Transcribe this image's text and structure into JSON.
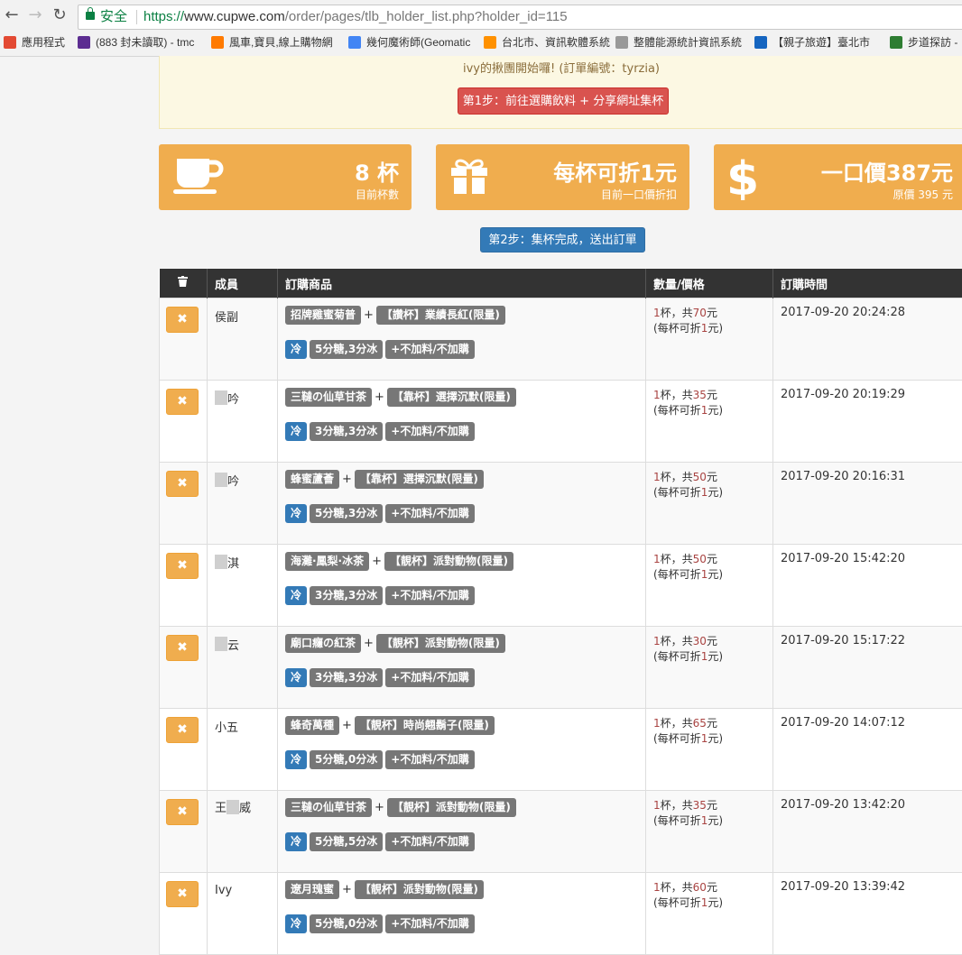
{
  "browser": {
    "secure_label": "安全",
    "url_scheme": "https://",
    "url_host": "www.cupwe.com",
    "url_path": "/order/pages/tlb_holder_list.php?holder_id=115",
    "bookmarks": [
      {
        "label": "應用程式",
        "color": "#e34a33"
      },
      {
        "label": "(883 封未讀取) - tmc",
        "color": "#5c2d91"
      },
      {
        "label": "風車,寶貝,線上購物網",
        "color": "#ff7a00"
      },
      {
        "label": "幾何魔術師(Geomatic",
        "color": "#4285f4"
      },
      {
        "label": "台北市、資訊軟體系統",
        "color": "#ff9100"
      },
      {
        "label": "整體能源統計資訊系統",
        "color": "#999999"
      },
      {
        "label": "【親子旅遊】臺北市",
        "color": "#1565c0"
      },
      {
        "label": "步道探訪 -",
        "color": "#2e7d32"
      }
    ]
  },
  "notice": {
    "text": "ivy的揪團開始囉! (訂單編號：tyrzia)",
    "step1_label": "第1步：前往選購飲料 + 分享網址集杯"
  },
  "stats": {
    "cups": {
      "big": "8 杯",
      "small": "目前杯數"
    },
    "discount": {
      "big": "每杯可折1元",
      "small": "目前一口價折扣"
    },
    "price": {
      "big": "一口價387元",
      "small": "原價 395 元"
    }
  },
  "step2_label": "第2步：集杯完成，送出訂單",
  "table": {
    "headers": {
      "member": "成員",
      "item": "訂購商品",
      "qty": "數量/價格",
      "time": "訂購時間"
    },
    "delete_glyph": "✖",
    "cold_label": "冷",
    "rows": [
      {
        "member_prefix": "",
        "member": "侯副",
        "drink": "招牌雞蜜菊普",
        "cup": "【讚杯】業績長紅(限量)",
        "sugar": "5分糖,3分冰",
        "topping": "+不加料/不加購",
        "cups": "1",
        "qty_mid": "杯，共",
        "total": "70",
        "qty_end": "元",
        "discount_pre": "(每杯可折",
        "discount": "1",
        "discount_post": "元)",
        "time": "2017-09-20 20:24:28",
        "blur": false
      },
      {
        "member_prefix": "",
        "member": "吟",
        "drink": "三韃の仙草甘茶",
        "cup": "【靠杯】選擇沉默(限量)",
        "sugar": "3分糖,3分冰",
        "topping": "+不加料/不加購",
        "cups": "1",
        "qty_mid": "杯，共",
        "total": "35",
        "qty_end": "元",
        "discount_pre": "(每杯可折",
        "discount": "1",
        "discount_post": "元)",
        "time": "2017-09-20 20:19:29",
        "blur": true
      },
      {
        "member_prefix": "",
        "member": "吟",
        "drink": "蜂蜜蘆薈",
        "cup": "【靠杯】選擇沉默(限量)",
        "sugar": "5分糖,3分冰",
        "topping": "+不加料/不加購",
        "cups": "1",
        "qty_mid": "杯，共",
        "total": "50",
        "qty_end": "元",
        "discount_pre": "(每杯可折",
        "discount": "1",
        "discount_post": "元)",
        "time": "2017-09-20 20:16:31",
        "blur": true
      },
      {
        "member_prefix": "",
        "member": "淇",
        "drink": "海灘·鳳梨·冰茶",
        "cup": "【靚杯】派對動物(限量)",
        "sugar": "3分糖,3分冰",
        "topping": "+不加料/不加購",
        "cups": "1",
        "qty_mid": "杯，共",
        "total": "50",
        "qty_end": "元",
        "discount_pre": "(每杯可折",
        "discount": "1",
        "discount_post": "元)",
        "time": "2017-09-20 15:42:20",
        "blur": true
      },
      {
        "member_prefix": "",
        "member": "云",
        "drink": "廟口癮の紅茶",
        "cup": "【靚杯】派對動物(限量)",
        "sugar": "3分糖,3分冰",
        "topping": "+不加料/不加購",
        "cups": "1",
        "qty_mid": "杯，共",
        "total": "30",
        "qty_end": "元",
        "discount_pre": "(每杯可折",
        "discount": "1",
        "discount_post": "元)",
        "time": "2017-09-20 15:17:22",
        "blur": true
      },
      {
        "member_prefix": "",
        "member": "小五",
        "drink": "蜂奇萬種",
        "cup": "【靚杯】時尚翹鬍子(限量)",
        "sugar": "5分糖,0分冰",
        "topping": "+不加料/不加購",
        "cups": "1",
        "qty_mid": "杯，共",
        "total": "65",
        "qty_end": "元",
        "discount_pre": "(每杯可折",
        "discount": "1",
        "discount_post": "元)",
        "time": "2017-09-20 14:07:12",
        "blur": false
      },
      {
        "member_prefix": "王",
        "member": "威",
        "drink": "三韃の仙草甘茶",
        "cup": "【靚杯】派對動物(限量)",
        "sugar": "5分糖,5分冰",
        "topping": "+不加料/不加購",
        "cups": "1",
        "qty_mid": "杯，共",
        "total": "35",
        "qty_end": "元",
        "discount_pre": "(每杯可折",
        "discount": "1",
        "discount_post": "元)",
        "time": "2017-09-20 13:42:20",
        "blur": true
      },
      {
        "member_prefix": "",
        "member": "Ivy",
        "drink": "遼月瑰蜜",
        "cup": "【靚杯】派對動物(限量)",
        "sugar": "5分糖,0分冰",
        "topping": "+不加料/不加購",
        "cups": "1",
        "qty_mid": "杯，共",
        "total": "60",
        "qty_end": "元",
        "discount_pre": "(每杯可折",
        "discount": "1",
        "discount_post": "元)",
        "time": "2017-09-20 13:39:42",
        "blur": false
      }
    ]
  }
}
